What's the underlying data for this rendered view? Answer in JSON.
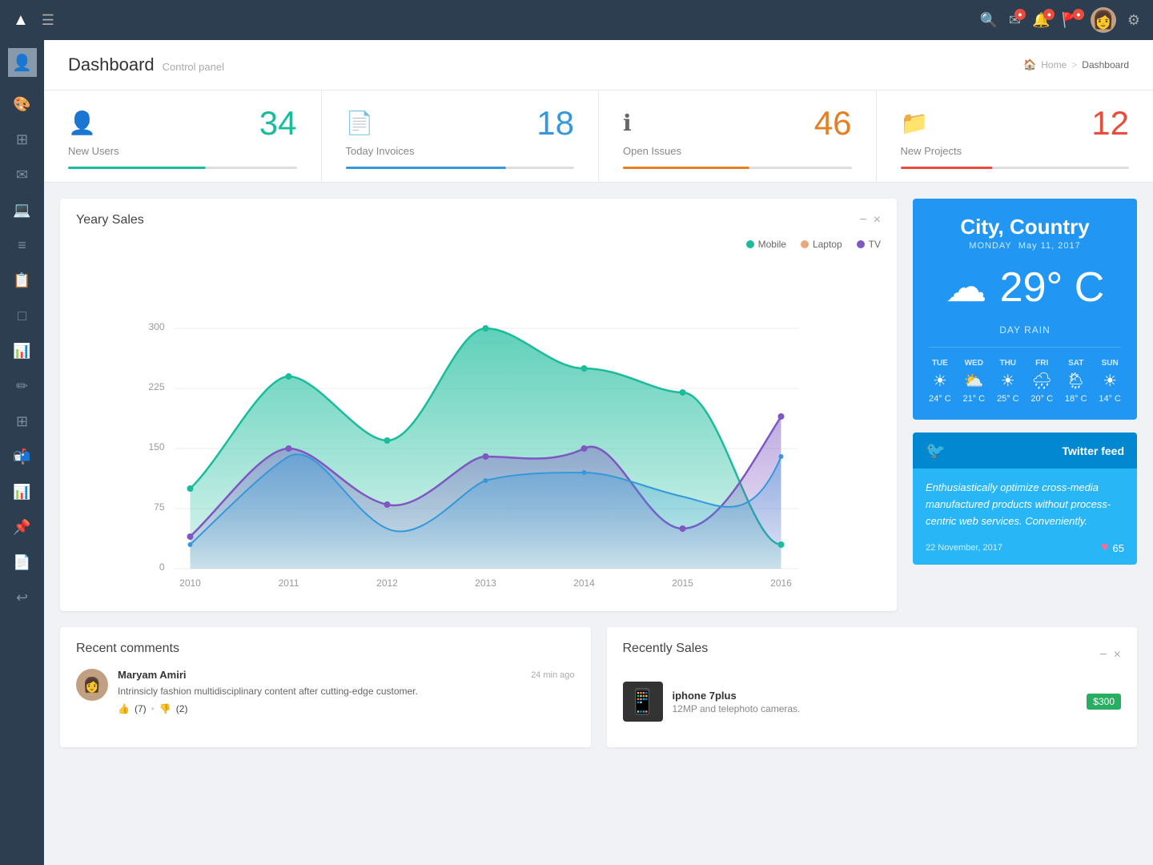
{
  "topnav": {
    "logo": "▲",
    "hamburger": "☰",
    "search_icon": "🔍",
    "mail_badge": "●",
    "bell_badge": "●",
    "flag_badge": "●",
    "gear_icon": "⚙"
  },
  "breadcrumb": {
    "home": "Home",
    "separator": ">",
    "current": "Dashboard"
  },
  "header": {
    "title": "Dashboard",
    "subtitle": "Control panel"
  },
  "stats": [
    {
      "icon": "👤",
      "number": "34",
      "label": "New Users",
      "color_class": "teal",
      "bar_class": "teal"
    },
    {
      "icon": "📄",
      "number": "18",
      "label": "Today Invoices",
      "color_class": "blue",
      "bar_class": "blue"
    },
    {
      "icon": "ℹ",
      "number": "46",
      "label": "Open Issues",
      "color_class": "orange",
      "bar_class": "orange"
    },
    {
      "icon": "📁",
      "number": "12",
      "label": "New Projects",
      "color_class": "red",
      "bar_class": "red"
    }
  ],
  "chart": {
    "title": "Yeary Sales",
    "legend": [
      {
        "label": "Mobile",
        "color": "#1abc9c"
      },
      {
        "label": "Laptop",
        "color": "#e8a87c"
      },
      {
        "label": "TV",
        "color": "#7e57c2"
      }
    ],
    "x_labels": [
      "2010",
      "2011",
      "2012",
      "2013",
      "2014",
      "2015",
      "2016"
    ],
    "y_labels": [
      "0",
      "75",
      "150",
      "225",
      "300"
    ],
    "minimize": "−",
    "close": "×"
  },
  "weather": {
    "city": "City,",
    "country": " Country",
    "day": "MONDAY",
    "date": "May 11, 2017",
    "temp": "29° C",
    "condition": "DAY RAIN",
    "forecast": [
      {
        "day": "TUE",
        "icon": "☀",
        "temp": "24° C"
      },
      {
        "day": "WED",
        "icon": "⛅",
        "temp": "21° C"
      },
      {
        "day": "THU",
        "icon": "☀",
        "temp": "25° C"
      },
      {
        "day": "FRI",
        "icon": "🌧",
        "temp": "20° C"
      },
      {
        "day": "SAT",
        "icon": "🌦",
        "temp": "18° C"
      },
      {
        "day": "SUN",
        "icon": "☀",
        "temp": "14° C"
      }
    ]
  },
  "twitter": {
    "title": "Twitter feed",
    "text": "Enthusiastically optimize cross-media manufactured products without process-centric web services. Conveniently.",
    "date": "22 November, 2017",
    "likes": "65"
  },
  "recent_comments": {
    "title": "Recent comments",
    "items": [
      {
        "name": "Maryam Amiri",
        "time": "24 min ago",
        "text": "Intrinsicly fashion multidisciplinary content after cutting-edge customer.",
        "thumbs_up": "(7)",
        "thumbs_down": "(2)"
      }
    ]
  },
  "recently_sales": {
    "title": "Recently Sales",
    "minimize": "−",
    "close": "×",
    "items": [
      {
        "name": "iphone 7plus",
        "desc": "12MP and telephoto cameras.",
        "price": "$300"
      }
    ]
  },
  "sidebar": {
    "items": [
      {
        "icon": "🎨",
        "name": "design"
      },
      {
        "icon": "⊞",
        "name": "grid"
      },
      {
        "icon": "✉",
        "name": "mail"
      },
      {
        "icon": "💻",
        "name": "laptop"
      },
      {
        "icon": "≡",
        "name": "menu"
      },
      {
        "icon": "📋",
        "name": "clipboard"
      },
      {
        "icon": "□",
        "name": "window"
      },
      {
        "icon": "📊",
        "name": "chart-pie"
      },
      {
        "icon": "✏",
        "name": "edit"
      },
      {
        "icon": "⊞",
        "name": "table"
      },
      {
        "icon": "📬",
        "name": "inbox"
      },
      {
        "icon": "📊",
        "name": "bar-chart"
      },
      {
        "icon": "📌",
        "name": "pin"
      },
      {
        "icon": "📄",
        "name": "document"
      },
      {
        "icon": "↩",
        "name": "reply"
      }
    ]
  }
}
